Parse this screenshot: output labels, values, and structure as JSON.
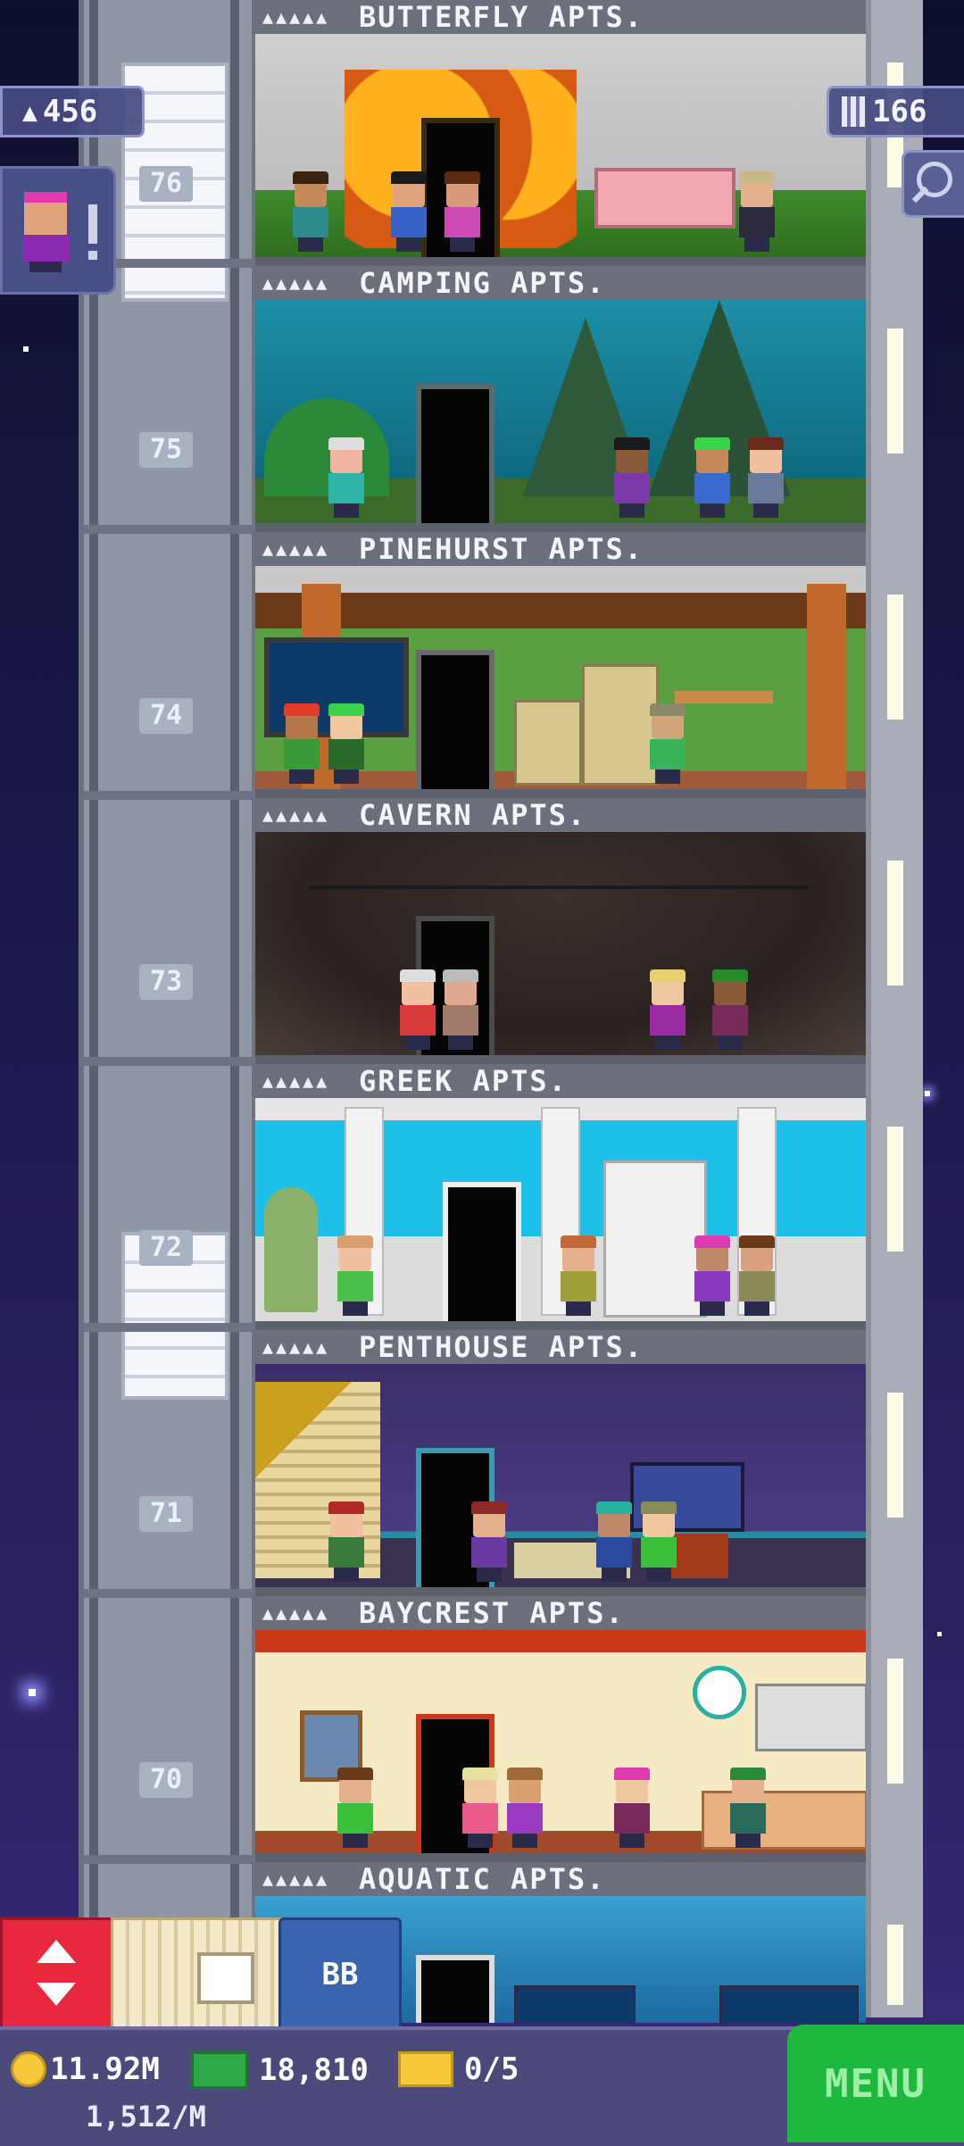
{
  "hud": {
    "population": "456",
    "floors": "166",
    "coins": "11.92M",
    "coins_rate": "1,512/M",
    "bux": "18,810",
    "tickets": "0/5",
    "menu_label": "MENU",
    "bb_label": "BB"
  },
  "floors": [
    {
      "number": "76",
      "name": "BUTTERFLY APTS.",
      "stars": "▲▲▲▲▲",
      "theme": "butterfly"
    },
    {
      "number": "75",
      "name": "CAMPING APTS.",
      "stars": "▲▲▲▲▲",
      "theme": "camping"
    },
    {
      "number": "74",
      "name": "PINEHURST APTS.",
      "stars": "▲▲▲▲▲",
      "theme": "pinehurst"
    },
    {
      "number": "73",
      "name": "CAVERN APTS.",
      "stars": "▲▲▲▲▲",
      "theme": "cavern"
    },
    {
      "number": "72",
      "name": "GREEK APTS.",
      "stars": "▲▲▲▲▲",
      "theme": "greek"
    },
    {
      "number": "71",
      "name": "PENTHOUSE APTS.",
      "stars": "▲▲▲▲▲",
      "theme": "penthouse"
    },
    {
      "number": "70",
      "name": "BAYCREST APTS.",
      "stars": "▲▲▲▲▲",
      "theme": "baycrest"
    },
    {
      "number": "",
      "name": "AQUATIC APTS.",
      "stars": "▲▲▲▲▲",
      "theme": "aquatic"
    }
  ],
  "icons": {
    "population": "person-icon",
    "floors": "building-icon",
    "search": "magnifier-icon",
    "elevator": "up-down-arrows-icon",
    "coins": "coin-icon",
    "bux": "bux-icon",
    "tickets": "ticket-icon"
  },
  "colors": {
    "menu_green": "#1eb83e",
    "elevator_red": "#e8283e",
    "bb_blue": "#3a63b0"
  }
}
